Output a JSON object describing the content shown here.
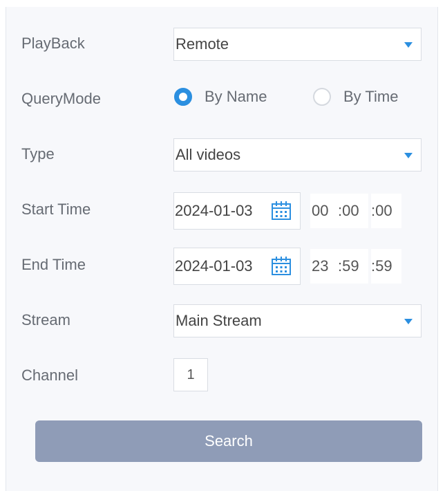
{
  "form": {
    "playback": {
      "label": "PlayBack",
      "value": "Remote"
    },
    "query_mode": {
      "label": "QueryMode",
      "options": [
        {
          "label": "By Name",
          "checked": true
        },
        {
          "label": "By Time",
          "checked": false
        }
      ]
    },
    "type": {
      "label": "Type",
      "value": "All videos"
    },
    "start_time": {
      "label": "Start Time",
      "date": "2024-01-03",
      "hour": "00",
      "minute": ":00",
      "second": ":00"
    },
    "end_time": {
      "label": "End Time",
      "date": "2024-01-03",
      "hour": "23",
      "minute": ":59",
      "second": ":59"
    },
    "stream": {
      "label": "Stream",
      "value": "Main Stream"
    },
    "channel": {
      "label": "Channel",
      "value": "1"
    },
    "search_label": "Search"
  },
  "icons": {
    "dropdown": "chevron-down-icon",
    "calendar": "calendar-icon"
  },
  "colors": {
    "accent": "#2b8fe0",
    "search_button": "#8f9cb7",
    "panel_bg": "#f7f8fb"
  }
}
